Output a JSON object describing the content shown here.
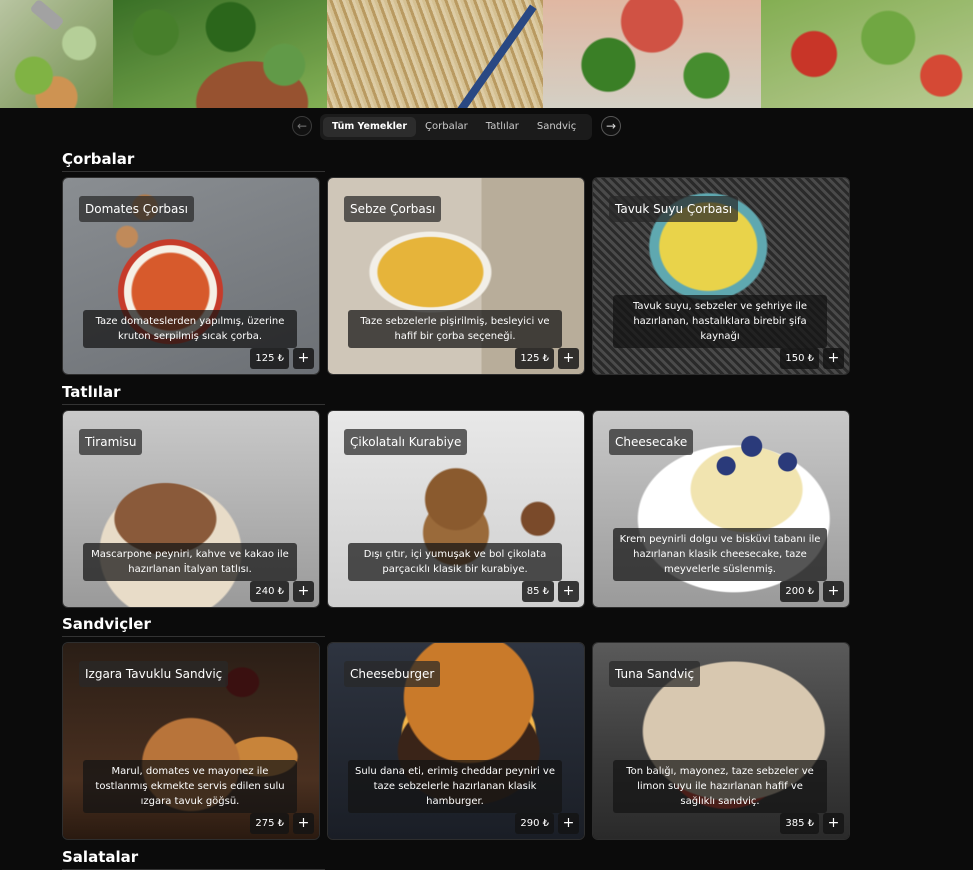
{
  "nav": {
    "prev_icon": "←",
    "next_icon": "→",
    "tabs": [
      {
        "label": "Tüm Yemekler",
        "active": true
      },
      {
        "label": "Çorbalar"
      },
      {
        "label": "Tatlılar"
      },
      {
        "label": "Sandviç"
      }
    ]
  },
  "sections": [
    {
      "title": "Çorbalar",
      "items": [
        {
          "name": "Domates Çorbası",
          "desc": "Taze domateslerden yapılmış, üzerine kruton serpilmiş sıcak çorba.",
          "price": "125 ₺"
        },
        {
          "name": "Sebze Çorbası",
          "desc": "Taze sebzelerle pişirilmiş, besleyici ve hafif bir çorba seçeneği.",
          "price": "125 ₺"
        },
        {
          "name": "Tavuk Suyu Çorbası",
          "desc": "Tavuk suyu, sebzeler ve şehriye ile hazırlanan, hastalıklara birebir şifa kaynağı",
          "price": "150 ₺"
        }
      ]
    },
    {
      "title": "Tatlılar",
      "items": [
        {
          "name": "Tiramisu",
          "desc": "Mascarpone peyniri, kahve ve kakao ile hazırlanan İtalyan tatlısı.",
          "price": "240 ₺"
        },
        {
          "name": "Çikolatalı Kurabiye",
          "desc": "Dışı çıtır, içi yumuşak ve bol çikolata parçacıklı klasik bir kurabiye.",
          "price": "85 ₺"
        },
        {
          "name": "Cheesecake",
          "desc": "Krem peynirli dolgu ve bisküvi tabanı ile hazırlanan klasik cheesecake, taze meyvelerle süslenmiş.",
          "price": "200 ₺"
        }
      ]
    },
    {
      "title": "Sandviçler",
      "items": [
        {
          "name": "Izgara Tavuklu Sandviç",
          "desc": "Marul, domates ve mayonez ile tostlanmış ekmekte servis edilen sulu ızgara tavuk göğsü.",
          "price": "275 ₺"
        },
        {
          "name": "Cheeseburger",
          "desc": "Sulu dana eti, erimiş cheddar peyniri ve taze sebzelerle hazırlanan klasik hamburger.",
          "price": "290 ₺"
        },
        {
          "name": "Tuna Sandviç",
          "desc": "Ton balığı, mayonez, taze sebzeler ve limon suyu ile hazırlanan hafif ve sağlıklı sandviç.",
          "price": "385 ₺"
        }
      ]
    },
    {
      "title": "Salatalar",
      "items": []
    }
  ],
  "add_label": "+"
}
